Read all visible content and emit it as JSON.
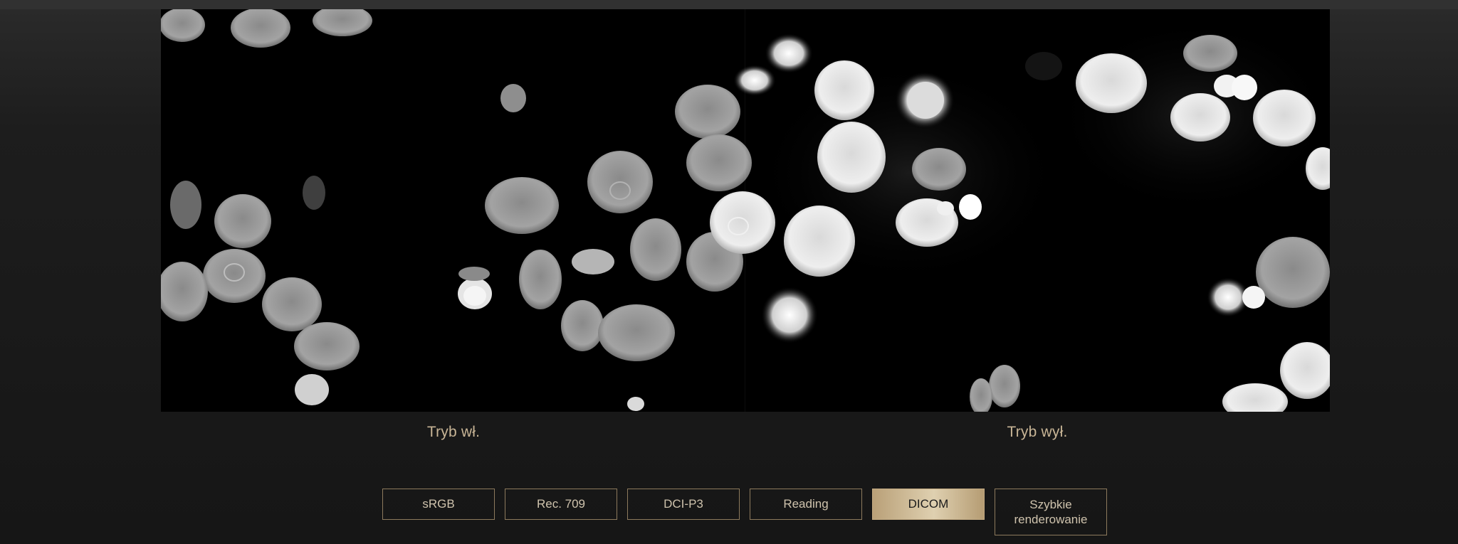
{
  "comparison": {
    "left_label": "Tryb wł.",
    "right_label": "Tryb wył."
  },
  "color_modes": [
    {
      "label": "sRGB",
      "active": false
    },
    {
      "label": "Rec. 709",
      "active": false
    },
    {
      "label": "DCI-P3",
      "active": false
    },
    {
      "label": "Reading",
      "active": false
    },
    {
      "label": "DICOM",
      "active": true
    },
    {
      "label": "Szybkie renderowanie",
      "active": false
    }
  ],
  "colors": {
    "accent_gold": "#c8b596",
    "active_button": "#d8c7a5",
    "button_border": "#8d7a5d"
  }
}
